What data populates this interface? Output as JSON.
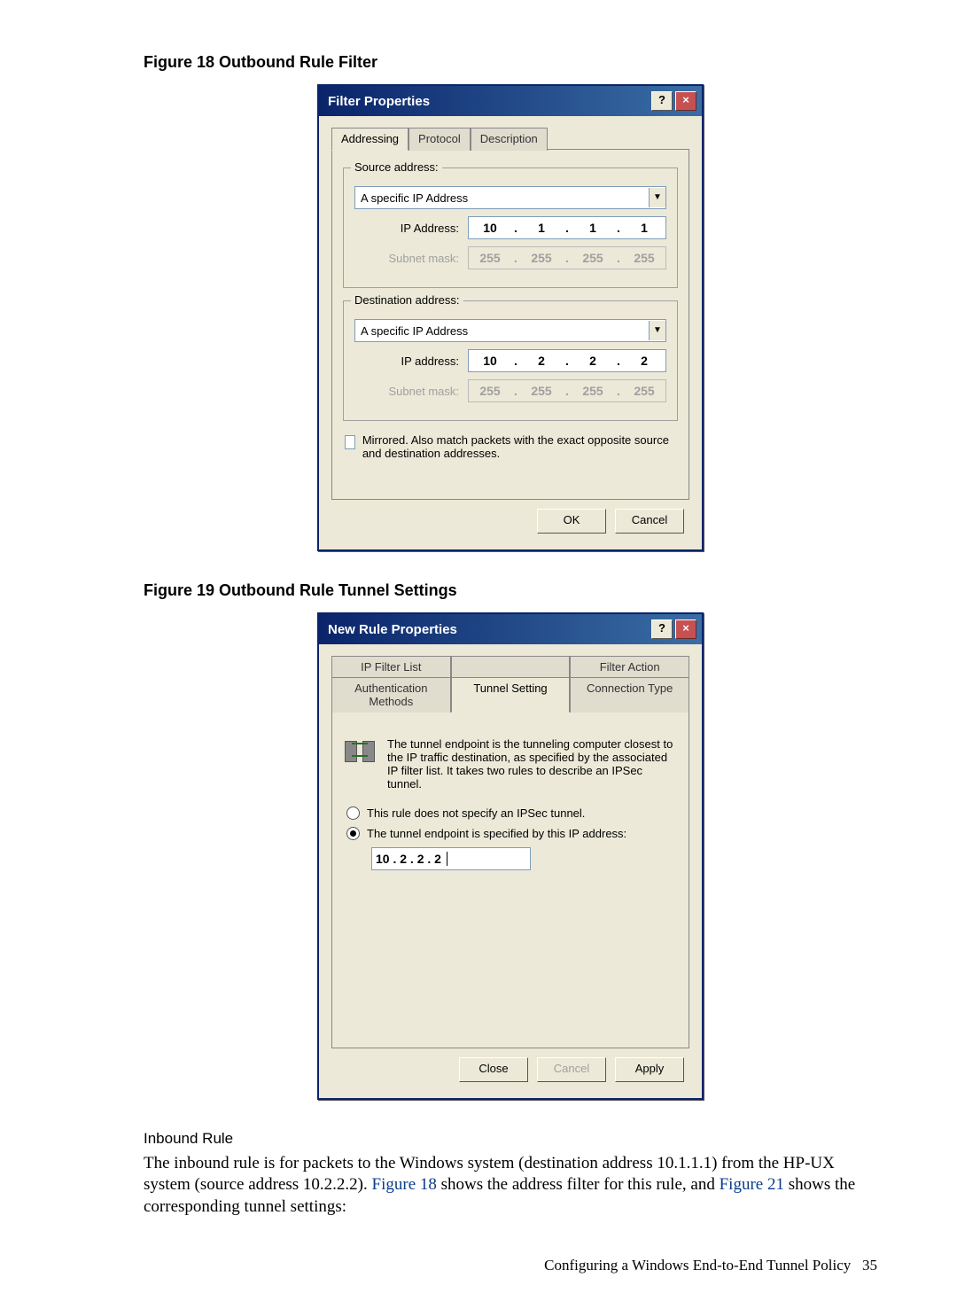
{
  "captions": {
    "fig18": "Figure 18 Outbound Rule Filter",
    "fig19": "Figure 19 Outbound Rule Tunnel Settings"
  },
  "dialog1": {
    "title": "Filter Properties",
    "help": "?",
    "close": "×",
    "tabs": {
      "addressing": "Addressing",
      "protocol": "Protocol",
      "description": "Description"
    },
    "source": {
      "legend": "Source address:",
      "dropdown": "A specific IP Address",
      "ip_label": "IP Address:",
      "ip": [
        "10",
        "1",
        "1",
        "1"
      ],
      "mask_label": "Subnet mask:",
      "mask": [
        "255",
        "255",
        "255",
        "255"
      ]
    },
    "dest": {
      "legend": "Destination address:",
      "dropdown": "A specific IP Address",
      "ip_label": "IP address:",
      "ip": [
        "10",
        "2",
        "2",
        "2"
      ],
      "mask_label": "Subnet mask:",
      "mask": [
        "255",
        "255",
        "255",
        "255"
      ]
    },
    "mirror": "Mirrored. Also match packets with the exact opposite source and destination addresses.",
    "ok": "OK",
    "cancel": "Cancel"
  },
  "dialog2": {
    "title": "New Rule Properties",
    "help": "?",
    "close": "×",
    "tabs": {
      "ip_filter_list": "IP Filter List",
      "filter_action": "Filter Action",
      "auth_methods": "Authentication Methods",
      "tunnel_setting": "Tunnel Setting",
      "connection_type": "Connection Type"
    },
    "info": "The tunnel endpoint is the tunneling computer closest to the IP traffic destination, as specified by the associated IP filter list. It takes two rules to describe an IPSec tunnel.",
    "radio1": "This rule does not specify an IPSec tunnel.",
    "radio2": "The tunnel endpoint is specified by this IP address:",
    "ip": "10 . 2 . 2 . 2",
    "close_btn": "Close",
    "cancel": "Cancel",
    "apply": "Apply"
  },
  "section": {
    "heading": "Inbound Rule",
    "para_a": "The inbound rule is for packets to the Windows system (destination address 10.1.1.1) from the HP-UX system (source address 10.2.2.2). ",
    "link1": "Figure 18",
    "para_b": " shows the address filter for this rule, and ",
    "link2": "Figure 21",
    "para_c": " shows the corresponding tunnel settings:"
  },
  "footer": {
    "text": "Configuring a Windows End-to-End Tunnel Policy",
    "page": "35"
  }
}
